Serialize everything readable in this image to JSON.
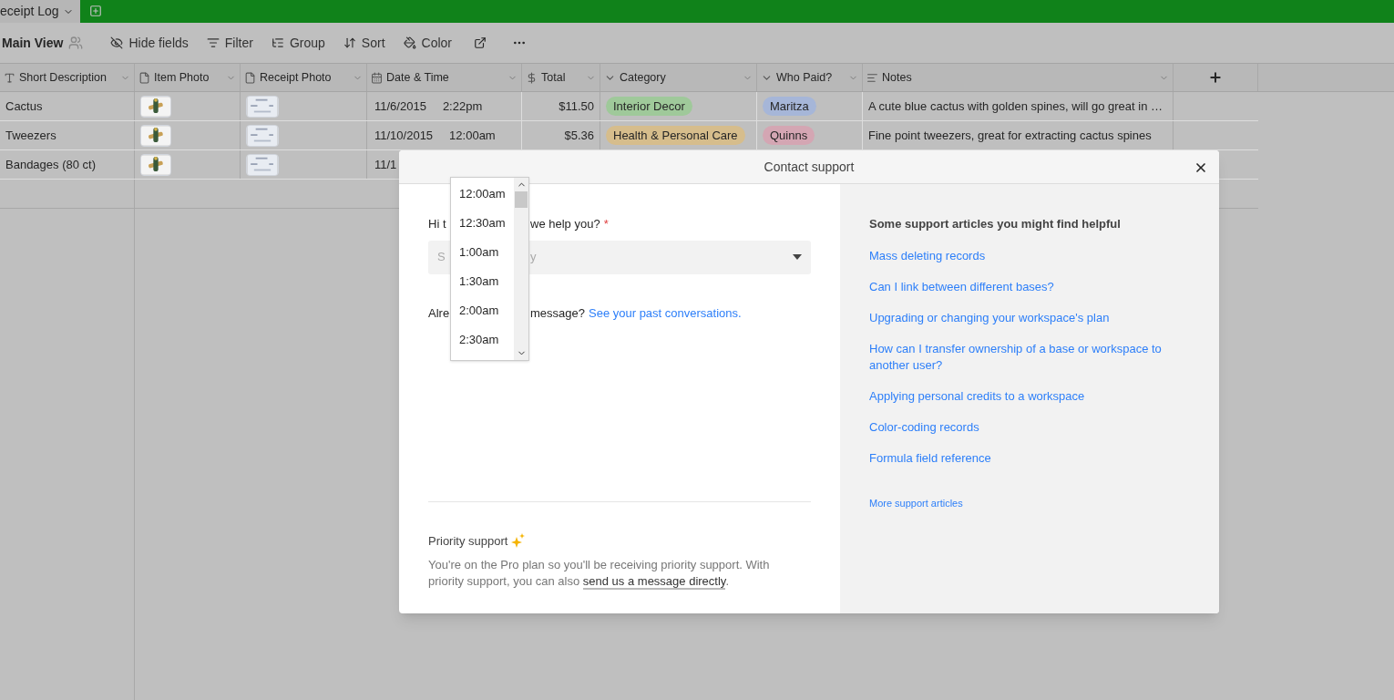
{
  "base_tab": {
    "label": "eceipt Log"
  },
  "toolbar": {
    "view_name": "Main View",
    "actions": [
      {
        "kind": "hide",
        "label": "Hide fields"
      },
      {
        "kind": "filter",
        "label": "Filter"
      },
      {
        "kind": "group",
        "label": "Group"
      },
      {
        "kind": "sort",
        "label": "Sort"
      },
      {
        "kind": "color",
        "label": "Color"
      }
    ]
  },
  "table": {
    "columns": [
      {
        "kind": "text",
        "label": "Short Description"
      },
      {
        "kind": "attachment",
        "label": "Item Photo"
      },
      {
        "kind": "attachment",
        "label": "Receipt Photo"
      },
      {
        "kind": "date",
        "label": "Date & Time"
      },
      {
        "kind": "currency",
        "label": "Total"
      },
      {
        "kind": "select",
        "label": "Category"
      },
      {
        "kind": "select",
        "label": "Who Paid?"
      },
      {
        "kind": "longtext",
        "label": "Notes"
      }
    ],
    "rows": [
      {
        "description": "Cactus",
        "date": "11/6/2015",
        "time": "2:22pm",
        "total": "$11.50",
        "category": {
          "label": "Interior Decor",
          "color": "#9fc99a"
        },
        "who_paid": {
          "label": "Maritza",
          "color": "#a6b6d8"
        },
        "notes": "A cute blue cactus with golden spines, will go great in …"
      },
      {
        "description": "Tweezers",
        "date": "11/10/2015",
        "time": "12:00am",
        "total": "$5.36",
        "category": {
          "label": "Health & Personal Care",
          "color": "#d6bd8c"
        },
        "who_paid": {
          "label": "Quinns",
          "color": "#d4a6b3"
        },
        "notes": "Fine point tweezers, great for extracting cactus spines"
      },
      {
        "description": "Bandages (80 ct)",
        "date": "11/1"
      }
    ]
  },
  "modal": {
    "title": "Contact support",
    "question": {
      "start": "Hi t",
      "end": "we help you?",
      "required_mark": "*"
    },
    "topic_field": {
      "placeholder_start": "S",
      "placeholder_end": "y"
    },
    "past": {
      "start": "Alre",
      "end": "message?",
      "link": "See your past conversations."
    },
    "time_dropdown": {
      "options": [
        "12:00am",
        "12:30am",
        "1:00am",
        "1:30am",
        "2:00am",
        "2:30am"
      ]
    },
    "priority": {
      "title": "Priority support",
      "text": "You're on the Pro plan so you'll be receiving priority support. With priority support, you can also ",
      "link": "send us a message directly",
      "end": "."
    },
    "articles": {
      "heading": "Some support articles you might find helpful",
      "links": [
        "Mass deleting records",
        "Can I link between different bases?",
        "Upgrading or changing your workspace's plan",
        "How can I transfer ownership of a base or workspace to another user?",
        "Applying personal credits to a workspace",
        "Color-coding records",
        "Formula field reference"
      ],
      "more": "More support articles"
    }
  }
}
